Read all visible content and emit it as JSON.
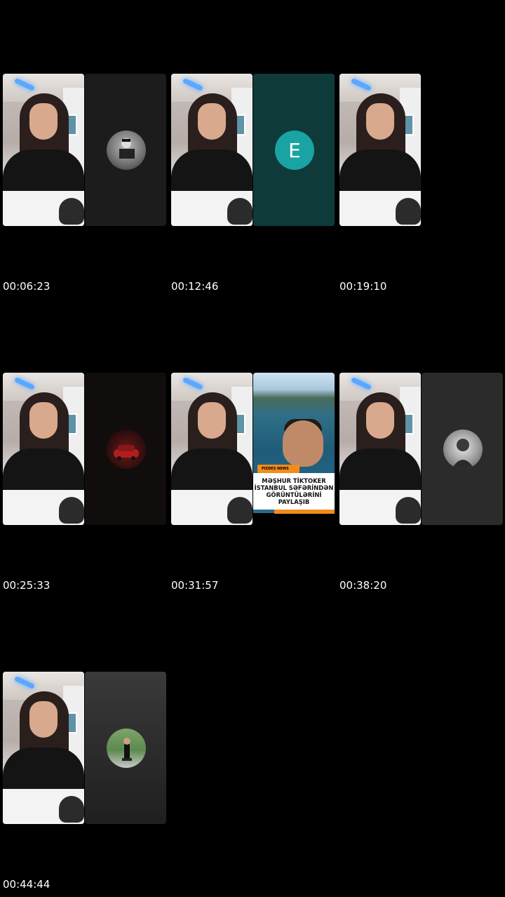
{
  "colors": {
    "background": "#000000",
    "timestamp_text": "#ffffff",
    "avatar_E": "#1aa3a3",
    "teal_panel": "#0f3a3a",
    "dark_panel": "#1c1c1c",
    "gray_panel": "#2b2b2b",
    "news_accent": "#f28c1b"
  },
  "thumbnails": [
    {
      "time": "00:06:23",
      "right_pane": "dark",
      "avatar": "vintage-photo-icon"
    },
    {
      "time": "00:12:46",
      "right_pane": "teal",
      "avatar": "letter",
      "avatar_letter": "E"
    },
    {
      "time": "00:19:10",
      "right_pane": "none"
    },
    {
      "time": "00:25:33",
      "right_pane": "dark",
      "avatar": "car-photo-icon"
    },
    {
      "time": "00:31:57",
      "right_pane": "news",
      "news": {
        "badge": "PIZDES NEWS",
        "headline": "MƏŞHUR TİKTOKER\nİSTANBUL SƏFƏRİNDƏN\nGÖRÜNTÜLƏRİNİ PAYLAŞIB"
      }
    },
    {
      "time": "00:38:20",
      "right_pane": "gray",
      "avatar": "portrait-photo-icon"
    },
    {
      "time": "00:44:44",
      "right_pane": "gray",
      "avatar": "person-outdoors-photo-icon"
    }
  ]
}
